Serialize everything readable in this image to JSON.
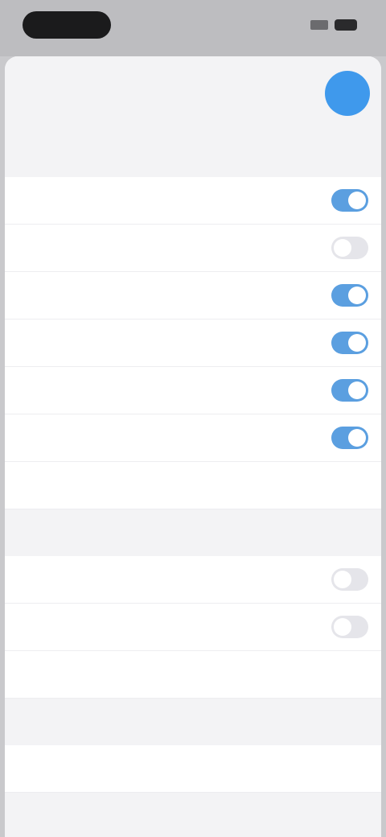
{
  "status": {
    "time": ""
  },
  "header": {
    "title": ""
  },
  "tabs": [
    "",
    "",
    "",
    ""
  ],
  "group1": [
    {
      "label": "",
      "toggle": "on"
    },
    {
      "label": "",
      "toggle": "off"
    },
    {
      "label": "",
      "toggle": "on"
    },
    {
      "label": "",
      "toggle": "on"
    },
    {
      "label": "",
      "toggle": "on"
    },
    {
      "label": "",
      "toggle": "on"
    },
    {
      "label": "",
      "toggle": "none"
    }
  ],
  "section2": {
    "header": ""
  },
  "group2": [
    {
      "label": "",
      "toggle": "off"
    },
    {
      "label": "",
      "toggle": "off"
    },
    {
      "label": "",
      "link": ""
    }
  ],
  "section3": {
    "header": ""
  },
  "group3": [
    {
      "label": ""
    }
  ],
  "footer": {
    "link": ""
  },
  "colors": {
    "accent": "#3f99ec",
    "toggle_on": "#5b9fe0",
    "background": "#f3f3f5"
  }
}
